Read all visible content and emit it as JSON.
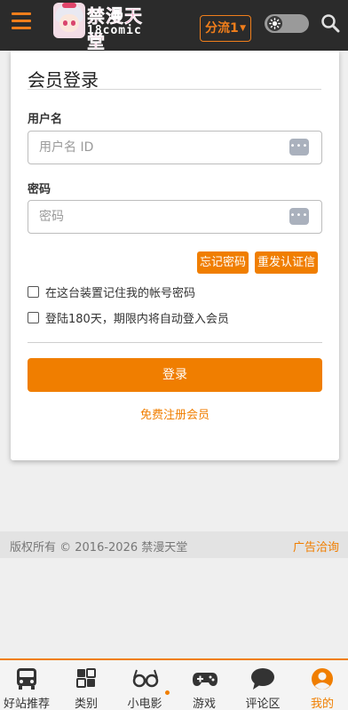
{
  "header": {
    "logo_title": "禁漫天堂",
    "logo_sub": "18comic",
    "stream_label": "分流1",
    "stream_caret": "▼",
    "theme_icon": "sun-icon"
  },
  "login": {
    "title": "会员登录",
    "username_label": "用户名",
    "username_placeholder": "用户名 ID",
    "password_label": "密码",
    "password_placeholder": "密码",
    "password_toggle": "•••",
    "forgot_password": "忘记密码",
    "resend_verification": "重发认证信",
    "remember_device": "在这台装置记住我的帐号密码",
    "auto_login": "登陆180天，期限内将自动登入会员",
    "login_button": "登录",
    "register_link": "免费注册会员"
  },
  "footer": {
    "copyright": "版权所有 © 2016-2026 禁漫天堂",
    "ad_link": "广告洽询"
  },
  "bottom_nav": {
    "items": [
      {
        "label": "好站推荐",
        "icon": "bus-icon"
      },
      {
        "label": "类别",
        "icon": "category-grid-icon"
      },
      {
        "label": "小电影",
        "icon": "glasses-icon"
      },
      {
        "label": "游戏",
        "icon": "gamepad-icon"
      },
      {
        "label": "评论区",
        "icon": "comment-icon"
      },
      {
        "label": "我的",
        "icon": "user-icon"
      }
    ]
  },
  "colors": {
    "accent": "#f07e00",
    "header_bg": "#2b2b2b",
    "page_bg": "#efefef"
  }
}
